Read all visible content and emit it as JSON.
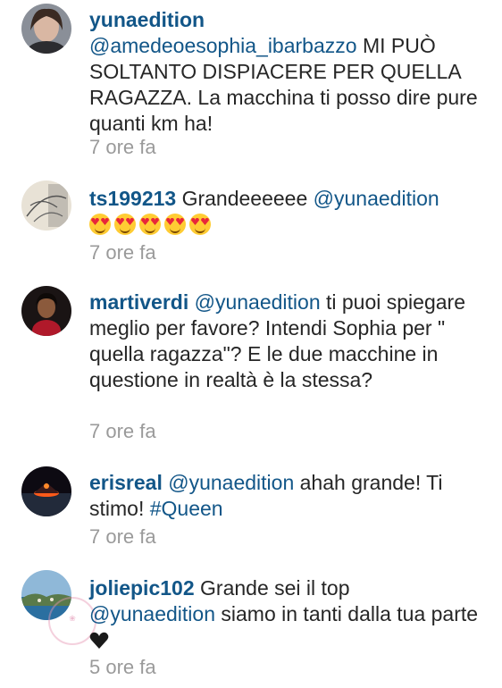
{
  "comments": [
    {
      "username": "yunaedition",
      "mention": "@amedeoesophia_ibarbazzo",
      "text": " MI PUÒ SOLTANTO DISPIACERE PER QUELLA RAGAZZA. La macchina ti posso dire pure quanti km ha!",
      "time": "7 ore fa"
    },
    {
      "username": "ts199213",
      "text": " Grandeeeeee ",
      "mention": "@yunaedition",
      "emoji_count": 5,
      "emoji": "heart-eyes-emoji",
      "time": "7 ore fa"
    },
    {
      "username": "martiverdi",
      "mention": "@yunaedition",
      "text": " ti puoi spiegare meglio per favore? Intendi Sophia per \" quella ragazza\"? E le due macchine in questione in realtà è la stessa?",
      "time": "7 ore fa"
    },
    {
      "username": "erisreal",
      "mention": "@yunaedition",
      "text": " ahah grande! Ti stimo! ",
      "hashtag": "#Queen",
      "time": "7 ore fa"
    },
    {
      "username": "joliepic102",
      "text": " Grande sei il top ",
      "mention": "@yunaedition",
      "text2": " siamo in tanti dalla tua parte ",
      "emoji": "black-heart-emoji",
      "time": "5 ore fa"
    }
  ],
  "colors": {
    "username": "#125688",
    "text": "#262626",
    "timestamp": "#9a9a9a",
    "emoji_yellow": "#ffcc33",
    "heart_red": "#e8263a"
  }
}
